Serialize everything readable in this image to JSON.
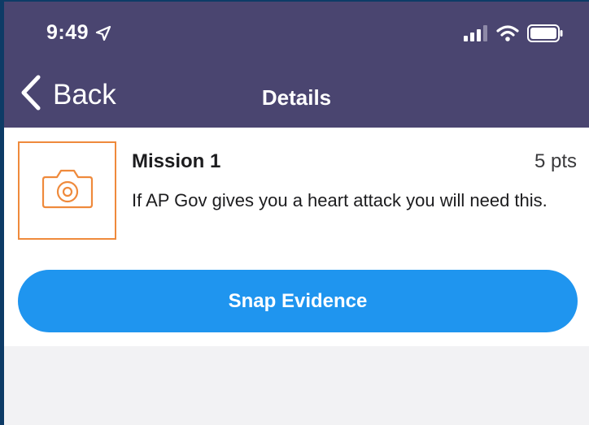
{
  "status_bar": {
    "time": "9:49",
    "location_icon": "location-arrow-icon",
    "signal_icon": "cellular-signal-icon",
    "wifi_icon": "wifi-icon",
    "battery_icon": "battery-icon"
  },
  "nav": {
    "back_label": "Back",
    "title": "Details",
    "background": "#4a4570"
  },
  "mission": {
    "title": "Mission 1",
    "points": "5 pts",
    "description": "If AP Gov gives you a heart attack you will need this.",
    "thumbnail_icon": "camera-icon",
    "accent": "#ef8a3c"
  },
  "actions": {
    "snap_label": "Snap Evidence",
    "snap_color": "#1f95ef"
  }
}
